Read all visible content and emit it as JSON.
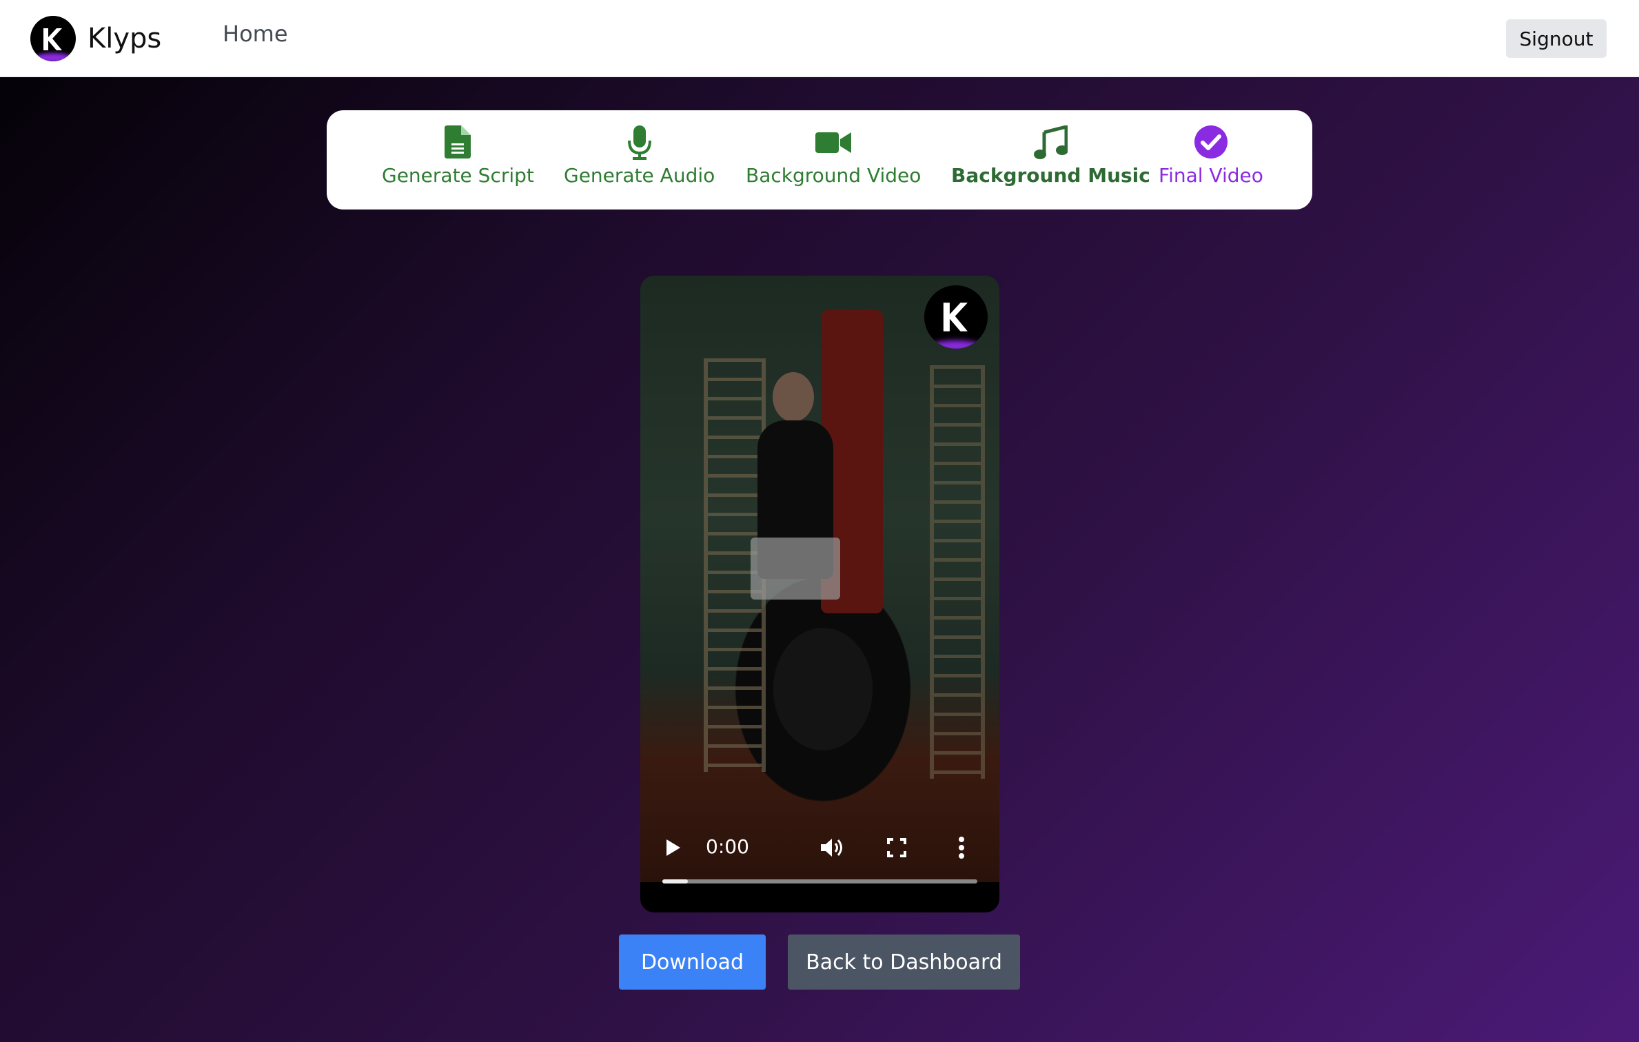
{
  "header": {
    "brand": "Klyps",
    "nav_home": "Home",
    "signout_label": "Signout"
  },
  "steps": [
    {
      "label": "Generate Script",
      "icon": "file-icon"
    },
    {
      "label": "Generate Audio",
      "icon": "microphone-icon"
    },
    {
      "label": "Background Video",
      "icon": "video-camera-icon"
    },
    {
      "label": "Background Music",
      "icon": "music-note-icon"
    },
    {
      "label": "Final Video",
      "icon": "check-circle-icon"
    }
  ],
  "video": {
    "time": "0:00",
    "progress_fraction": 0.08
  },
  "actions": {
    "download_label": "Download",
    "dashboard_label": "Back to Dashboard"
  },
  "colors": {
    "step_green": "#2e7d32",
    "step_active": "#8a2be2",
    "download_blue": "#3b82f6",
    "dashboard_gray": "#4b5563"
  }
}
